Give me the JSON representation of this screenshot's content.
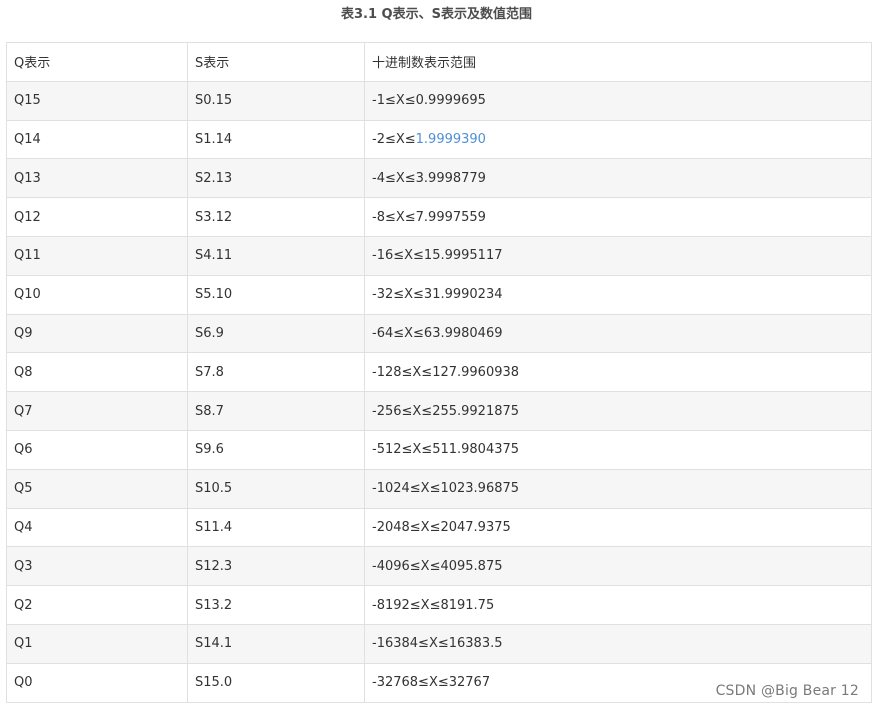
{
  "caption": "表3.1 Q表示、S表示及数值范围",
  "headers": [
    "Q表示",
    "S表示",
    "十进制数表示范围"
  ],
  "rows": [
    {
      "q": "Q15",
      "s": "S0.15",
      "range": "-1≤X≤0.9999695"
    },
    {
      "q": "Q14",
      "s": "S1.14",
      "range_prefix": "-2≤X≤",
      "range_link": "1.9999390"
    },
    {
      "q": "Q13",
      "s": "S2.13",
      "range": "-4≤X≤3.9998779"
    },
    {
      "q": "Q12",
      "s": "S3.12",
      "range": "-8≤X≤7.9997559"
    },
    {
      "q": "Q11",
      "s": "S4.11",
      "range": "-16≤X≤15.9995117"
    },
    {
      "q": "Q10",
      "s": "S5.10",
      "range": "-32≤X≤31.9990234"
    },
    {
      "q": "Q9",
      "s": "S6.9",
      "range": "-64≤X≤63.9980469"
    },
    {
      "q": "Q8",
      "s": "S7.8",
      "range": "-128≤X≤127.9960938"
    },
    {
      "q": "Q7",
      "s": "S8.7",
      "range": "-256≤X≤255.9921875"
    },
    {
      "q": "Q6",
      "s": "S9.6",
      "range": "-512≤X≤511.9804375"
    },
    {
      "q": "Q5",
      "s": "S10.5",
      "range": "-1024≤X≤1023.96875"
    },
    {
      "q": "Q4",
      "s": "S11.4",
      "range": "-2048≤X≤2047.9375"
    },
    {
      "q": "Q3",
      "s": "S12.3",
      "range": "-4096≤X≤4095.875"
    },
    {
      "q": "Q2",
      "s": "S13.2",
      "range": "-8192≤X≤8191.75"
    },
    {
      "q": "Q1",
      "s": "S14.1",
      "range": "-16384≤X≤16383.5"
    },
    {
      "q": "Q0",
      "s": "S15.0",
      "range": "-32768≤X≤32767"
    }
  ],
  "watermark": "CSDN @Big Bear 12",
  "colors": {
    "link": "#4f8fd6",
    "stripe": "#f6f6f6",
    "border": "#e0e0e0"
  }
}
